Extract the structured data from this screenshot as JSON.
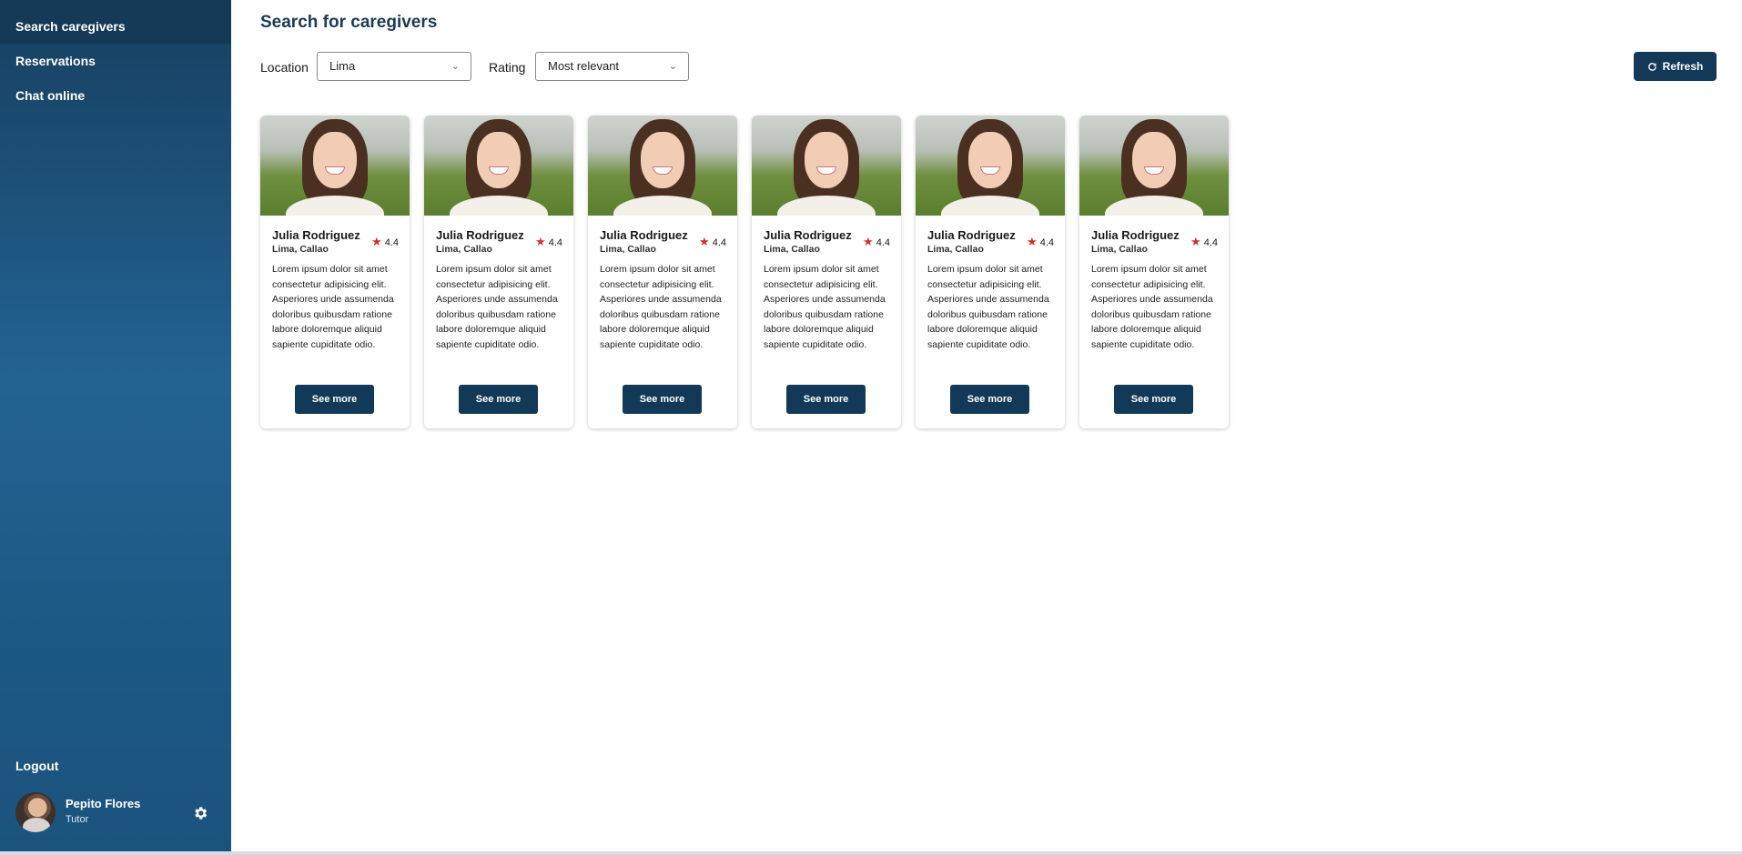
{
  "sidebar": {
    "items": [
      {
        "label": "Search caregivers",
        "active": true
      },
      {
        "label": "Reservations",
        "active": false
      },
      {
        "label": "Chat online",
        "active": false
      }
    ],
    "logout_label": "Logout",
    "user": {
      "name": "Pepito Flores",
      "role": "Tutor"
    }
  },
  "main": {
    "title": "Search for caregivers",
    "filters": {
      "location_label": "Location",
      "location_value": "Lima",
      "rating_label": "Rating",
      "rating_value": "Most relevant"
    },
    "refresh_label": "Refresh",
    "cards": [
      {
        "name": "Julia Rodriguez",
        "location": "Lima, Callao",
        "rating": "4.4",
        "description": "Lorem ipsum dolor sit amet consectetur adipisicing elit. Asperiores unde assumenda doloribus quibusdam ratione labore doloremque aliquid sapiente cupiditate odio.",
        "button": "See more"
      },
      {
        "name": "Julia Rodriguez",
        "location": "Lima, Callao",
        "rating": "4.4",
        "description": "Lorem ipsum dolor sit amet consectetur adipisicing elit. Asperiores unde assumenda doloribus quibusdam ratione labore doloremque aliquid sapiente cupiditate odio.",
        "button": "See more"
      },
      {
        "name": "Julia Rodriguez",
        "location": "Lima, Callao",
        "rating": "4.4",
        "description": "Lorem ipsum dolor sit amet consectetur adipisicing elit. Asperiores unde assumenda doloribus quibusdam ratione labore doloremque aliquid sapiente cupiditate odio.",
        "button": "See more"
      },
      {
        "name": "Julia Rodriguez",
        "location": "Lima, Callao",
        "rating": "4.4",
        "description": "Lorem ipsum dolor sit amet consectetur adipisicing elit. Asperiores unde assumenda doloribus quibusdam ratione labore doloremque aliquid sapiente cupiditate odio.",
        "button": "See more"
      },
      {
        "name": "Julia Rodriguez",
        "location": "Lima, Callao",
        "rating": "4.4",
        "description": "Lorem ipsum dolor sit amet consectetur adipisicing elit. Asperiores unde assumenda doloribus quibusdam ratione labore doloremque aliquid sapiente cupiditate odio.",
        "button": "See more"
      },
      {
        "name": "Julia Rodriguez",
        "location": "Lima, Callao",
        "rating": "4.4",
        "description": "Lorem ipsum dolor sit amet consectetur adipisicing elit. Asperiores unde assumenda doloribus quibusdam ratione labore doloremque aliquid sapiente cupiditate odio.",
        "button": "See more"
      }
    ]
  },
  "icons": {
    "settings": "gear-icon",
    "refresh": "refresh-icon",
    "rating": "star-icon",
    "dropdown": "chevron-down-icon"
  },
  "colors": {
    "primary": "#123957",
    "sidebar_active": "#143a58",
    "star": "#d32f2f",
    "title": "#1b3a57"
  }
}
